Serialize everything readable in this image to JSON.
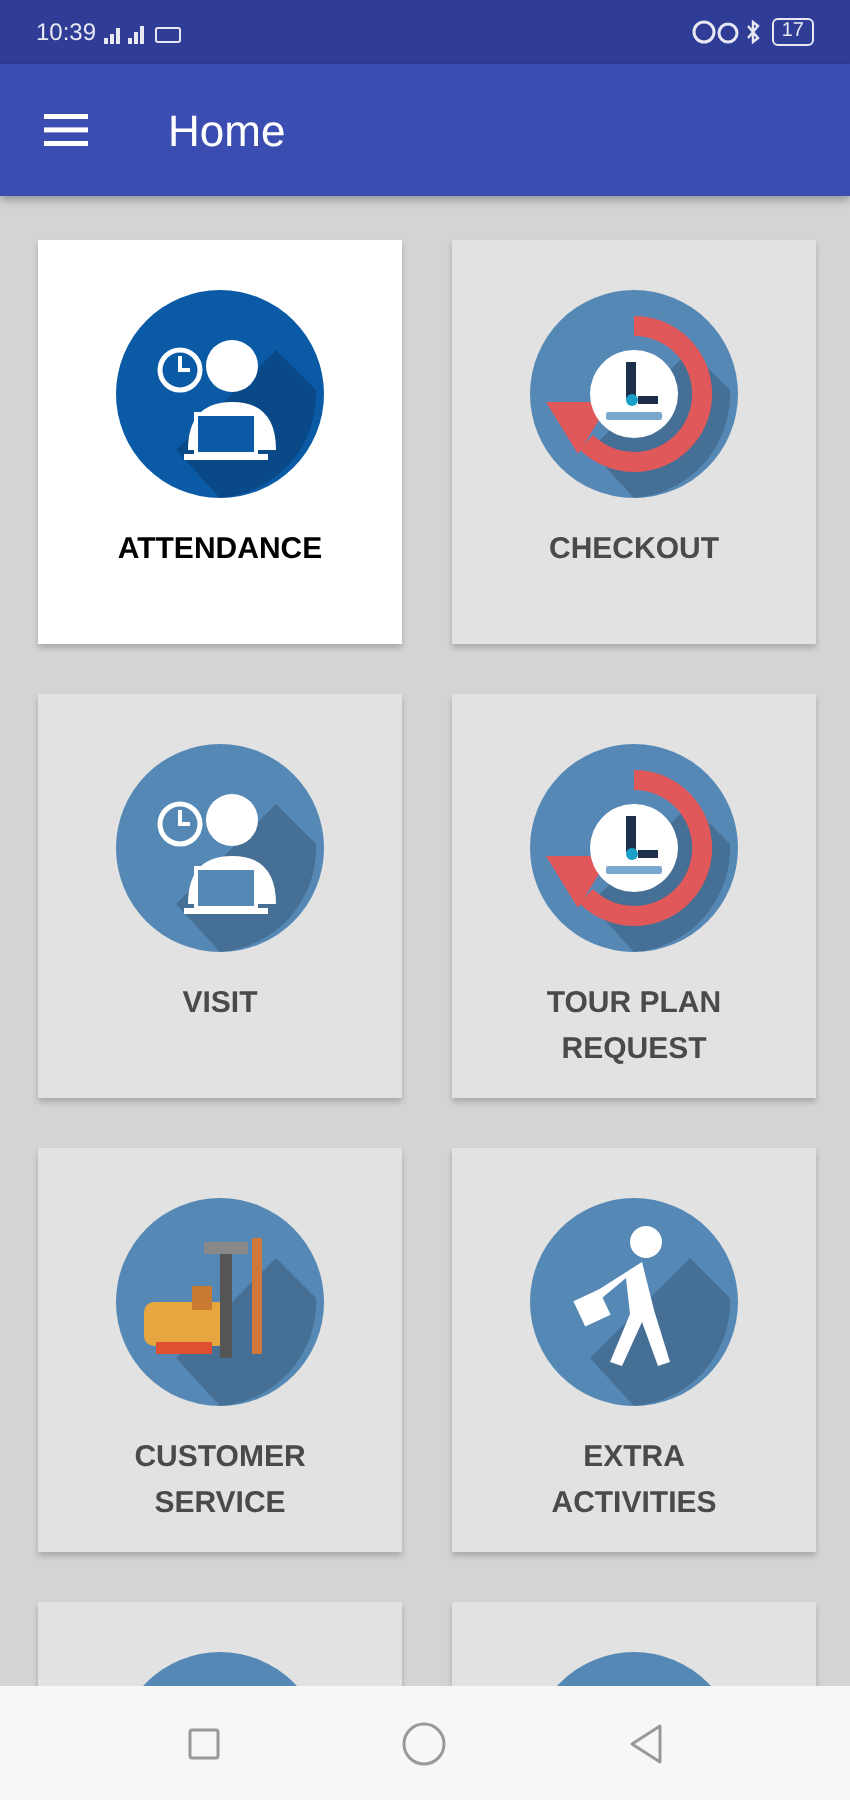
{
  "status_bar": {
    "time": "10:39",
    "battery": "17"
  },
  "app_bar": {
    "title": "Home"
  },
  "tiles": [
    {
      "label": "ATTENDANCE",
      "kind": "person",
      "selected": true
    },
    {
      "label": "CHECKOUT",
      "kind": "checkout",
      "selected": false
    },
    {
      "label": "VISIT",
      "kind": "person",
      "selected": false
    },
    {
      "label": "TOUR PLAN REQUEST",
      "kind": "checkout",
      "selected": false
    },
    {
      "label": "CUSTOMER SERVICE",
      "kind": "tools",
      "selected": false
    },
    {
      "label": "EXTRA ACTIVITIES",
      "kind": "walker",
      "selected": false
    },
    {
      "kind": "blank",
      "selected": false
    },
    {
      "kind": "blank",
      "selected": false
    }
  ]
}
